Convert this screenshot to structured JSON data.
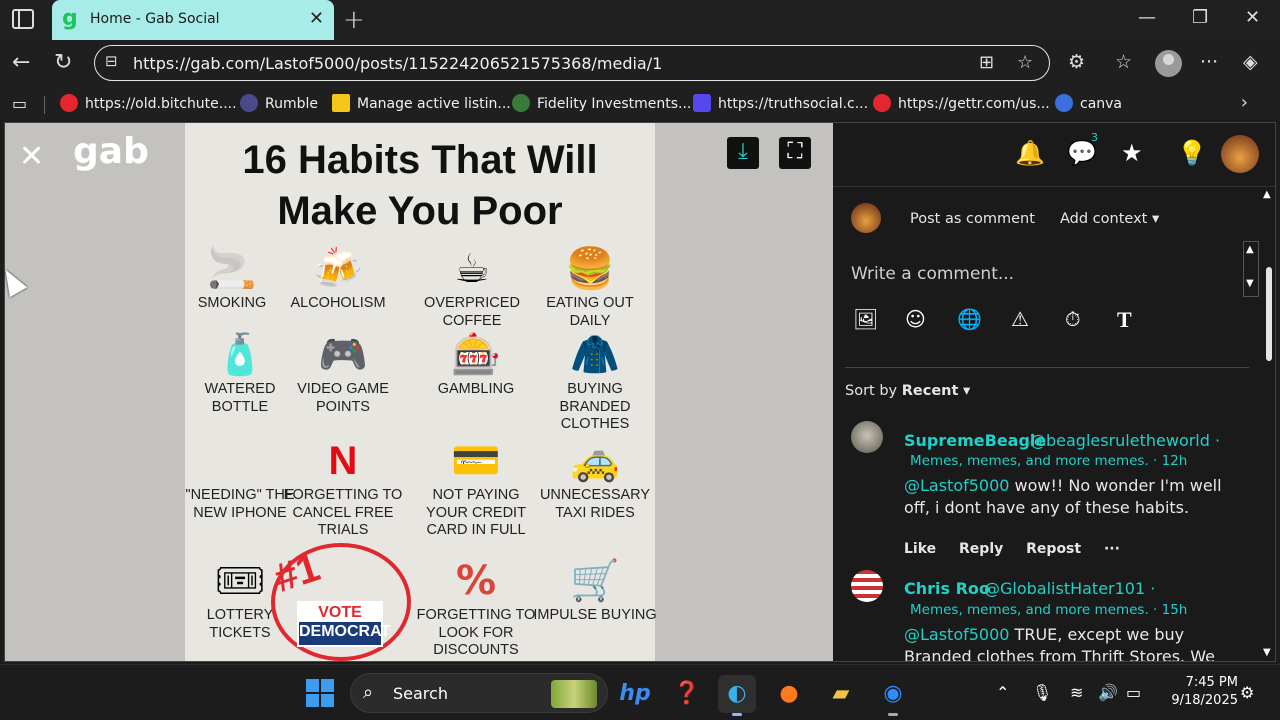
{
  "browser": {
    "tab_title": "Home - Gab Social",
    "tab_favicon": "g",
    "url": "https://gab.com/Lastof5000/posts/115224206521575368/media/1",
    "bookmarks": [
      {
        "label": "https://old.bitchute....",
        "color": "#e3262f"
      },
      {
        "label": "Rumble",
        "color": "#4a4a8a"
      },
      {
        "label": "Manage active listin...",
        "color": "#f5c518"
      },
      {
        "label": "Fidelity Investments...",
        "color": "#3a7a3a"
      },
      {
        "label": "https://truthsocial.c...",
        "color": "#5448ee"
      },
      {
        "label": "https://gettr.com/us...",
        "color": "#e3262f"
      },
      {
        "label": "canva",
        "color": "#3b6fe0"
      }
    ]
  },
  "media": {
    "logo": "gab",
    "title_line1": "16 Habits That Will",
    "title_line2": "Make You Poor",
    "habits": [
      {
        "label": "SMOKING",
        "icon": "🚬"
      },
      {
        "label": "ALCOHOLISM",
        "icon": "🍻"
      },
      {
        "label": "OVERPRICED COFFEE",
        "icon": "☕"
      },
      {
        "label": "EATING OUT DAILY",
        "icon": "🍔"
      },
      {
        "label": "WATERED BOTTLE",
        "icon": "🧴"
      },
      {
        "label": "VIDEO GAME POINTS",
        "icon": "🎮"
      },
      {
        "label": "GAMBLING",
        "icon": "🎰"
      },
      {
        "label": "BUYING BRANDED CLOTHES",
        "icon": "🧥"
      },
      {
        "label": "\"NEEDING\" THE NEW IPHONE",
        "icon": ""
      },
      {
        "label": "FORGETTING TO CANCEL FREE TRIALS",
        "icon": "N"
      },
      {
        "label": "NOT PAYING YOUR CREDIT CARD IN FULL",
        "icon": "💳"
      },
      {
        "label": "UNNECESSARY TAXI RIDES",
        "icon": "🚕"
      },
      {
        "label": "LOTTERY TICKETS",
        "icon": "🎟"
      },
      {
        "label": "FORGETTING TO LOOK FOR DISCOUNTS",
        "icon": "%"
      },
      {
        "label": "IMPULSE BUYING",
        "icon": "🛒"
      }
    ],
    "vote_badge_line1": "VOTE",
    "vote_badge_line2": "DEMOCRAT",
    "vote_rank": "#1"
  },
  "side": {
    "chat_count": "3",
    "post_as_comment": "Post as comment",
    "add_context": "Add context",
    "comment_placeholder": "Write a comment...",
    "sort_prefix": "Sort by",
    "sort_value": "Recent",
    "comments": [
      {
        "name": "SupremeBeagle",
        "handle": "@beaglesruletheworld ·",
        "group": "Memes, memes, and more memes.",
        "time": "· 12h",
        "mention": "@Lastof5000",
        "text": " wow!! No wonder I'm well off, i dont have any of these habits.",
        "actions": [
          "Like",
          "Reply",
          "Repost",
          "···"
        ]
      },
      {
        "name": "Chris Roo",
        "handle": "@GlobalistHater101 ·",
        "group": "Memes, memes, and more memes.",
        "time": "· 15h",
        "mention": "@Lastof5000",
        "text": " TRUE, except we buy Branded clothes from Thrift Stores. We"
      }
    ]
  },
  "taskbar": {
    "search_label": "Search",
    "time": "7:45 PM",
    "date": "9/18/2025"
  }
}
